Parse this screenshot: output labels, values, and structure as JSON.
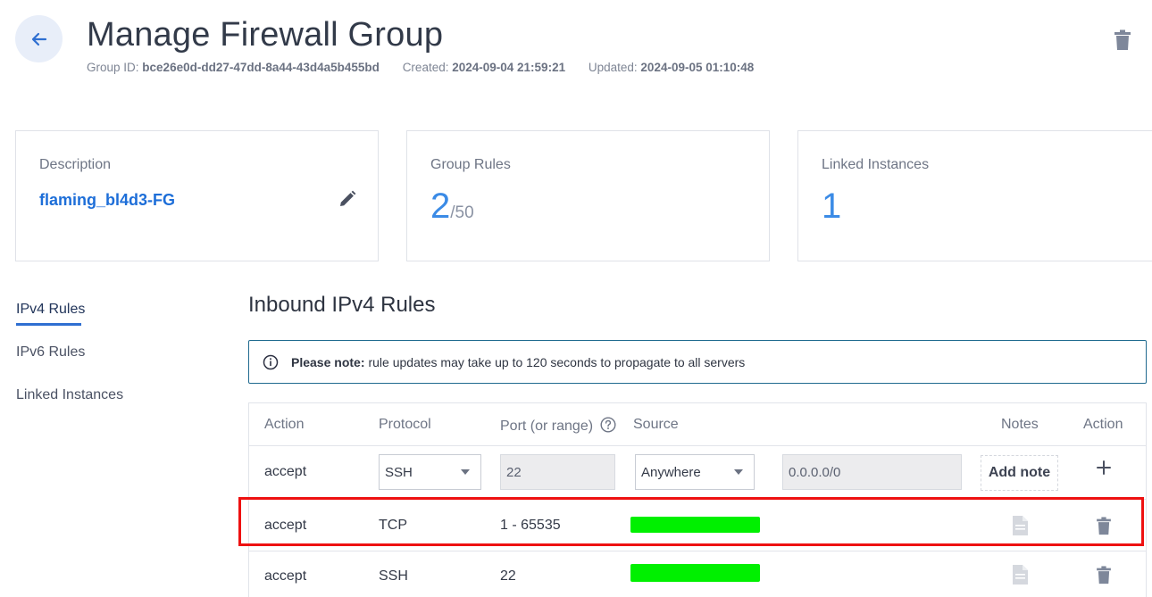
{
  "header": {
    "title": "Manage Firewall Group",
    "group_id_label": "Group ID:",
    "group_id": "bce26e0d-dd27-47dd-8a44-43d4a5b455bd",
    "created_label": "Created:",
    "created": "2024-09-04 21:59:21",
    "updated_label": "Updated:",
    "updated": "2024-09-05 01:10:48"
  },
  "cards": {
    "description": {
      "label": "Description",
      "value": "flaming_bl4d3-FG"
    },
    "group_rules": {
      "label": "Group Rules",
      "count": "2",
      "max": "/50"
    },
    "linked_instances": {
      "label": "Linked Instances",
      "count": "1"
    }
  },
  "side_nav": {
    "items": [
      {
        "label": "IPv4 Rules",
        "active": true
      },
      {
        "label": "IPv6 Rules",
        "active": false
      },
      {
        "label": "Linked Instances",
        "active": false
      }
    ]
  },
  "section": {
    "title": "Inbound IPv4 Rules"
  },
  "notice": {
    "bold": "Please note:",
    "text": "rule updates may take up to 120 seconds to propagate to all servers"
  },
  "table": {
    "headers": {
      "action": "Action",
      "protocol": "Protocol",
      "port": "Port (or range)",
      "source": "Source",
      "notes": "Notes",
      "action2": "Action"
    },
    "new_rule": {
      "action": "accept",
      "protocol": "SSH",
      "port": "22",
      "source": "Anywhere",
      "cidr": "0.0.0.0/0",
      "add_note_label": "Add note"
    },
    "rows": [
      {
        "action": "accept",
        "protocol": "TCP",
        "port": "1 - 65535"
      },
      {
        "action": "accept",
        "protocol": "SSH",
        "port": "22"
      }
    ]
  },
  "colors": {
    "accent": "#1d6ed8",
    "highlight": "#ee1111",
    "redaction": "#00f000"
  }
}
